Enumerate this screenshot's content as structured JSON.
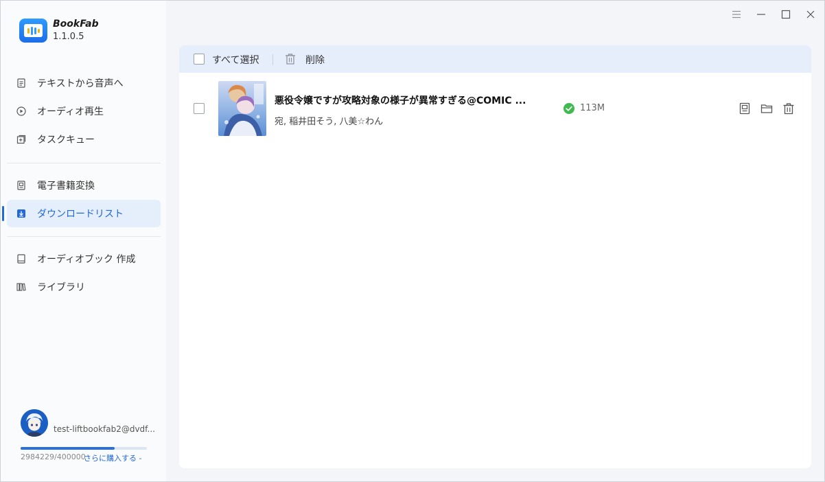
{
  "app": {
    "name": "BookFab",
    "version": "1.1.0.5"
  },
  "nav": {
    "items": [
      {
        "label": "テキストから音声へ",
        "icon": "document-icon"
      },
      {
        "label": "オーディオ再生",
        "icon": "play-circle-icon"
      },
      {
        "label": "タスクキュー",
        "icon": "add-square-icon"
      },
      {
        "label": "電子書籍変換",
        "icon": "ebook-icon"
      },
      {
        "label": "ダウンロードリスト",
        "icon": "download-icon",
        "active": true
      },
      {
        "label": "オーディオブック 作成",
        "icon": "book-icon"
      },
      {
        "label": "ライブラリ",
        "icon": "library-icon"
      }
    ]
  },
  "user": {
    "email": "test-liftbookfab2@dvdf...",
    "quota_text": "2984229/4000000",
    "quota_fraction": 0.746,
    "buy_link": "さらに購入する -"
  },
  "window_controls": [
    "menu-icon",
    "minimize-icon",
    "maximize-icon",
    "close-icon"
  ],
  "toolbar": {
    "select_all": "すべて選択",
    "delete": "削除"
  },
  "downloads": [
    {
      "title": "悪役令嬢ですが攻略対象の様子が異常すぎる@COMIC ...",
      "author": "宛, 稲井田そう, 八美☆わん",
      "size": "113M",
      "status": "completed"
    }
  ],
  "colors": {
    "accent": "#2468d9",
    "active_bg": "#e5effc",
    "success": "#3fb950",
    "toolbar_bg": "#e6eefc"
  }
}
